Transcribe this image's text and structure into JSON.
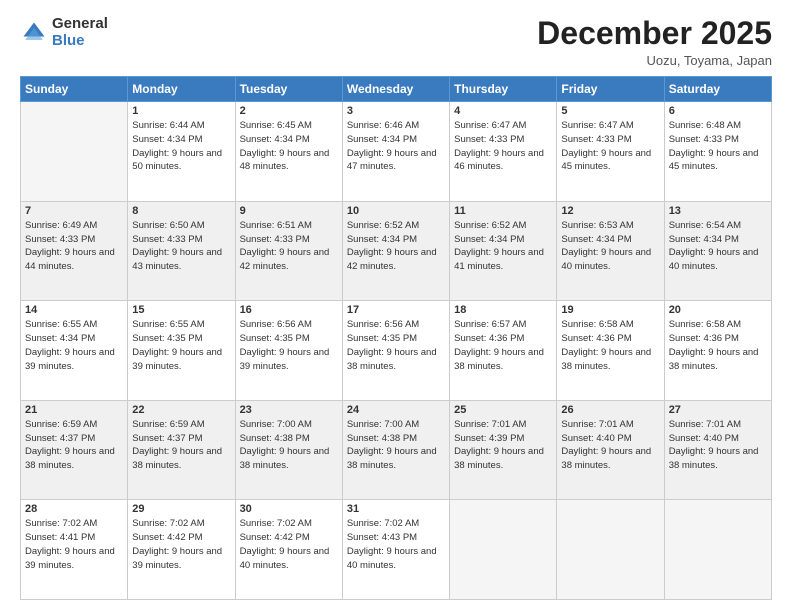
{
  "header": {
    "logo_general": "General",
    "logo_blue": "Blue",
    "month_title": "December 2025",
    "location": "Uozu, Toyama, Japan"
  },
  "days_of_week": [
    "Sunday",
    "Monday",
    "Tuesday",
    "Wednesday",
    "Thursday",
    "Friday",
    "Saturday"
  ],
  "weeks": [
    [
      {
        "day": "",
        "sunrise": "",
        "sunset": "",
        "daylight": "",
        "empty": true
      },
      {
        "day": "1",
        "sunrise": "Sunrise: 6:44 AM",
        "sunset": "Sunset: 4:34 PM",
        "daylight": "Daylight: 9 hours and 50 minutes."
      },
      {
        "day": "2",
        "sunrise": "Sunrise: 6:45 AM",
        "sunset": "Sunset: 4:34 PM",
        "daylight": "Daylight: 9 hours and 48 minutes."
      },
      {
        "day": "3",
        "sunrise": "Sunrise: 6:46 AM",
        "sunset": "Sunset: 4:34 PM",
        "daylight": "Daylight: 9 hours and 47 minutes."
      },
      {
        "day": "4",
        "sunrise": "Sunrise: 6:47 AM",
        "sunset": "Sunset: 4:33 PM",
        "daylight": "Daylight: 9 hours and 46 minutes."
      },
      {
        "day": "5",
        "sunrise": "Sunrise: 6:47 AM",
        "sunset": "Sunset: 4:33 PM",
        "daylight": "Daylight: 9 hours and 45 minutes."
      },
      {
        "day": "6",
        "sunrise": "Sunrise: 6:48 AM",
        "sunset": "Sunset: 4:33 PM",
        "daylight": "Daylight: 9 hours and 45 minutes."
      }
    ],
    [
      {
        "day": "7",
        "sunrise": "Sunrise: 6:49 AM",
        "sunset": "Sunset: 4:33 PM",
        "daylight": "Daylight: 9 hours and 44 minutes."
      },
      {
        "day": "8",
        "sunrise": "Sunrise: 6:50 AM",
        "sunset": "Sunset: 4:33 PM",
        "daylight": "Daylight: 9 hours and 43 minutes."
      },
      {
        "day": "9",
        "sunrise": "Sunrise: 6:51 AM",
        "sunset": "Sunset: 4:33 PM",
        "daylight": "Daylight: 9 hours and 42 minutes."
      },
      {
        "day": "10",
        "sunrise": "Sunrise: 6:52 AM",
        "sunset": "Sunset: 4:34 PM",
        "daylight": "Daylight: 9 hours and 42 minutes."
      },
      {
        "day": "11",
        "sunrise": "Sunrise: 6:52 AM",
        "sunset": "Sunset: 4:34 PM",
        "daylight": "Daylight: 9 hours and 41 minutes."
      },
      {
        "day": "12",
        "sunrise": "Sunrise: 6:53 AM",
        "sunset": "Sunset: 4:34 PM",
        "daylight": "Daylight: 9 hours and 40 minutes."
      },
      {
        "day": "13",
        "sunrise": "Sunrise: 6:54 AM",
        "sunset": "Sunset: 4:34 PM",
        "daylight": "Daylight: 9 hours and 40 minutes."
      }
    ],
    [
      {
        "day": "14",
        "sunrise": "Sunrise: 6:55 AM",
        "sunset": "Sunset: 4:34 PM",
        "daylight": "Daylight: 9 hours and 39 minutes."
      },
      {
        "day": "15",
        "sunrise": "Sunrise: 6:55 AM",
        "sunset": "Sunset: 4:35 PM",
        "daylight": "Daylight: 9 hours and 39 minutes."
      },
      {
        "day": "16",
        "sunrise": "Sunrise: 6:56 AM",
        "sunset": "Sunset: 4:35 PM",
        "daylight": "Daylight: 9 hours and 39 minutes."
      },
      {
        "day": "17",
        "sunrise": "Sunrise: 6:56 AM",
        "sunset": "Sunset: 4:35 PM",
        "daylight": "Daylight: 9 hours and 38 minutes."
      },
      {
        "day": "18",
        "sunrise": "Sunrise: 6:57 AM",
        "sunset": "Sunset: 4:36 PM",
        "daylight": "Daylight: 9 hours and 38 minutes."
      },
      {
        "day": "19",
        "sunrise": "Sunrise: 6:58 AM",
        "sunset": "Sunset: 4:36 PM",
        "daylight": "Daylight: 9 hours and 38 minutes."
      },
      {
        "day": "20",
        "sunrise": "Sunrise: 6:58 AM",
        "sunset": "Sunset: 4:36 PM",
        "daylight": "Daylight: 9 hours and 38 minutes."
      }
    ],
    [
      {
        "day": "21",
        "sunrise": "Sunrise: 6:59 AM",
        "sunset": "Sunset: 4:37 PM",
        "daylight": "Daylight: 9 hours and 38 minutes."
      },
      {
        "day": "22",
        "sunrise": "Sunrise: 6:59 AM",
        "sunset": "Sunset: 4:37 PM",
        "daylight": "Daylight: 9 hours and 38 minutes."
      },
      {
        "day": "23",
        "sunrise": "Sunrise: 7:00 AM",
        "sunset": "Sunset: 4:38 PM",
        "daylight": "Daylight: 9 hours and 38 minutes."
      },
      {
        "day": "24",
        "sunrise": "Sunrise: 7:00 AM",
        "sunset": "Sunset: 4:38 PM",
        "daylight": "Daylight: 9 hours and 38 minutes."
      },
      {
        "day": "25",
        "sunrise": "Sunrise: 7:01 AM",
        "sunset": "Sunset: 4:39 PM",
        "daylight": "Daylight: 9 hours and 38 minutes."
      },
      {
        "day": "26",
        "sunrise": "Sunrise: 7:01 AM",
        "sunset": "Sunset: 4:40 PM",
        "daylight": "Daylight: 9 hours and 38 minutes."
      },
      {
        "day": "27",
        "sunrise": "Sunrise: 7:01 AM",
        "sunset": "Sunset: 4:40 PM",
        "daylight": "Daylight: 9 hours and 38 minutes."
      }
    ],
    [
      {
        "day": "28",
        "sunrise": "Sunrise: 7:02 AM",
        "sunset": "Sunset: 4:41 PM",
        "daylight": "Daylight: 9 hours and 39 minutes."
      },
      {
        "day": "29",
        "sunrise": "Sunrise: 7:02 AM",
        "sunset": "Sunset: 4:42 PM",
        "daylight": "Daylight: 9 hours and 39 minutes."
      },
      {
        "day": "30",
        "sunrise": "Sunrise: 7:02 AM",
        "sunset": "Sunset: 4:42 PM",
        "daylight": "Daylight: 9 hours and 40 minutes."
      },
      {
        "day": "31",
        "sunrise": "Sunrise: 7:02 AM",
        "sunset": "Sunset: 4:43 PM",
        "daylight": "Daylight: 9 hours and 40 minutes."
      },
      {
        "day": "",
        "sunrise": "",
        "sunset": "",
        "daylight": "",
        "empty": true
      },
      {
        "day": "",
        "sunrise": "",
        "sunset": "",
        "daylight": "",
        "empty": true
      },
      {
        "day": "",
        "sunrise": "",
        "sunset": "",
        "daylight": "",
        "empty": true
      }
    ]
  ]
}
